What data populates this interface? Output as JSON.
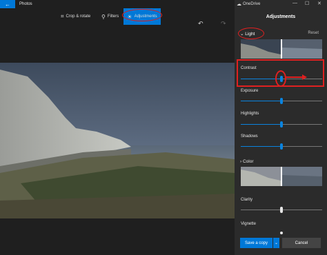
{
  "titlebar": {
    "app_title": "Photos",
    "back_icon": "back-arrow-icon"
  },
  "toolbar": {
    "crop_label": "Crop & rotate",
    "filters_label": "Filters",
    "adjustments_label": "Adjustments",
    "undo_icon": "undo-icon",
    "redo_icon": "redo-icon"
  },
  "panel": {
    "onedrive_label": "OneDrive",
    "heading": "Adjustments",
    "light_label": "Light",
    "reset_label": "Reset",
    "sliders": {
      "contrast": {
        "label": "Contrast",
        "value": 0.5
      },
      "exposure": {
        "label": "Exposure",
        "value": 0.5
      },
      "highlights": {
        "label": "Highlights",
        "value": 0.5
      },
      "shadows": {
        "label": "Shadows",
        "value": 0.5
      },
      "clarity": {
        "label": "Clarity",
        "value": 0.5
      },
      "vignette": {
        "label": "Vignette",
        "value": 0.5
      }
    },
    "color_label": "Color",
    "save_label": "Save a copy",
    "cancel_label": "Cancel"
  },
  "colors": {
    "accent": "#0078d7",
    "annotation": "#e02020",
    "panel_bg": "#2b2b2b"
  }
}
